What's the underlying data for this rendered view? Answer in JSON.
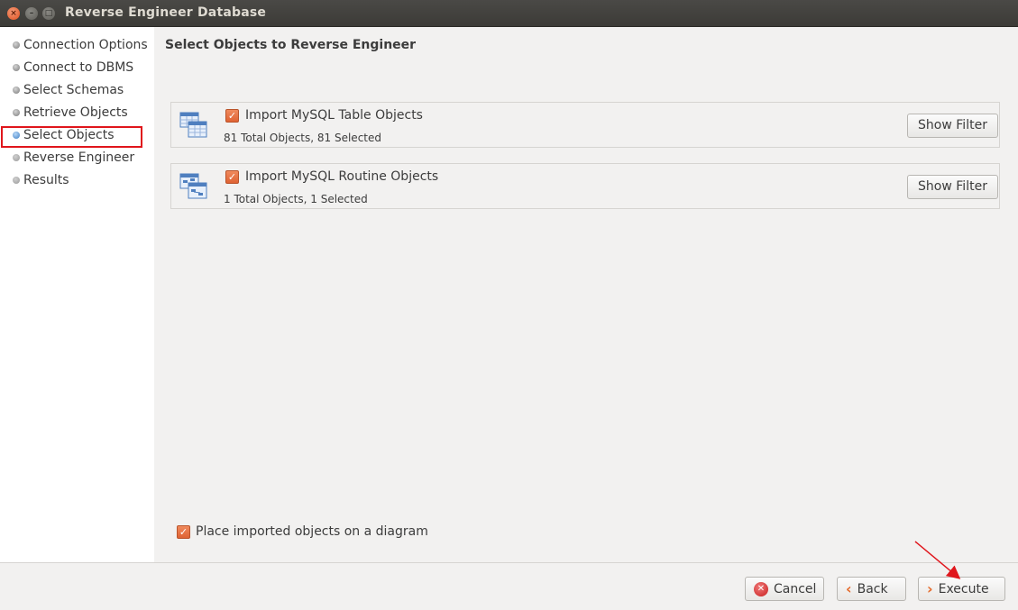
{
  "window": {
    "title": "Reverse Engineer Database",
    "controls": {
      "close": "×",
      "minimize": "–",
      "maximize": "□"
    }
  },
  "sidebar": {
    "steps": [
      {
        "label": "Connection Options",
        "state": "done"
      },
      {
        "label": "Connect to DBMS",
        "state": "done"
      },
      {
        "label": "Select Schemas",
        "state": "done"
      },
      {
        "label": "Retrieve Objects",
        "state": "done"
      },
      {
        "label": "Select Objects",
        "state": "current"
      },
      {
        "label": "Reverse Engineer",
        "state": "pending"
      },
      {
        "label": "Results",
        "state": "pending"
      }
    ]
  },
  "main": {
    "title": "Select Objects to Reverse Engineer",
    "groups": [
      {
        "icon": "table-objects-icon",
        "label": "Import MySQL Table Objects",
        "checked": true,
        "summary": "81 Total Objects, 81 Selected",
        "button": "Show Filter"
      },
      {
        "icon": "routine-objects-icon",
        "label": "Import MySQL Routine Objects",
        "checked": true,
        "summary": "1 Total Objects, 1 Selected",
        "button": "Show Filter"
      }
    ],
    "diagram_option": {
      "label": "Place imported objects on a diagram",
      "checked": true
    }
  },
  "footer": {
    "cancel": "Cancel",
    "back": "Back",
    "execute": "Execute"
  },
  "colors": {
    "checkbox": "#df6233",
    "annotation": "#e0161c",
    "current_step": "#3c7dc4"
  }
}
